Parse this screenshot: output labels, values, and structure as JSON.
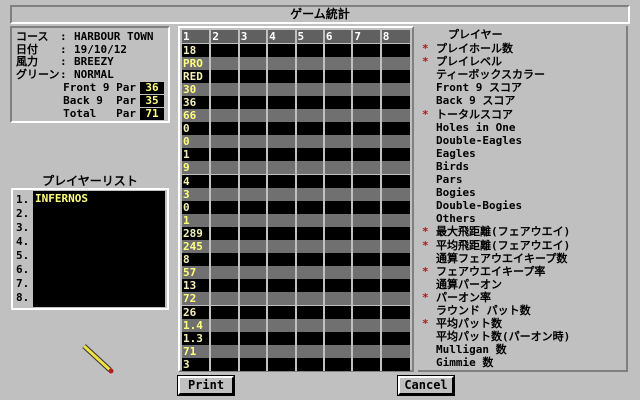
{
  "title": "ゲーム統計",
  "course_info": {
    "rows": [
      {
        "key": "コース",
        "value": "HARBOUR TOWN"
      },
      {
        "key": "日付",
        "value": "19/10/12"
      },
      {
        "key": "風力",
        "value": "BREEZY"
      },
      {
        "key": "グリーン",
        "value": "NORMAL"
      }
    ],
    "separator": ":",
    "pars": [
      {
        "label": "Front 9 Par",
        "value": "36"
      },
      {
        "label": "Back 9  Par",
        "value": "35"
      },
      {
        "label": "Total   Par",
        "value": "71"
      }
    ]
  },
  "player_list": {
    "label": "プレイヤーリスト",
    "numbers": [
      "1.",
      "2.",
      "3.",
      "4.",
      "5.",
      "6.",
      "7.",
      "8."
    ],
    "players": [
      "INFERNOS"
    ]
  },
  "grid": {
    "columns": [
      "1",
      "2",
      "3",
      "4",
      "5",
      "6",
      "7",
      "8"
    ],
    "player1_values": [
      "18",
      "PRO",
      "RED",
      "30",
      "36",
      "66",
      "0",
      "0",
      "1",
      "9",
      "4",
      "3",
      "0",
      "1",
      "289",
      "245",
      "8",
      "57",
      "13",
      "72",
      "26",
      "1.4",
      "1.3",
      "71",
      "3"
    ]
  },
  "stats": {
    "header": "プレイヤー",
    "star": "*",
    "labels": [
      {
        "text": "プレイホール数",
        "star": true
      },
      {
        "text": "プレイレベル",
        "star": true
      },
      {
        "text": "ティーボックスカラー",
        "star": false
      },
      {
        "text": "Front 9 スコア",
        "star": false
      },
      {
        "text": "Back 9 スコア",
        "star": false
      },
      {
        "text": "トータルスコア",
        "star": true
      },
      {
        "text": "Holes in One",
        "star": false
      },
      {
        "text": "Double-Eagles",
        "star": false
      },
      {
        "text": "Eagles",
        "star": false
      },
      {
        "text": "Birds",
        "star": false
      },
      {
        "text": "Pars",
        "star": false
      },
      {
        "text": "Bogies",
        "star": false
      },
      {
        "text": "Double-Bogies",
        "star": false
      },
      {
        "text": "Others",
        "star": false
      },
      {
        "text": "最大飛距離(フェアウエイ)",
        "star": true
      },
      {
        "text": "平均飛距離(フェアウエイ)",
        "star": true
      },
      {
        "text": "通算フェアウエイキープ数",
        "star": false
      },
      {
        "text": "フェアウエイキープ率",
        "star": true
      },
      {
        "text": "通算パーオン",
        "star": false
      },
      {
        "text": "パーオン率",
        "star": true
      },
      {
        "text": "ラウンド パット数",
        "star": false
      },
      {
        "text": "平均パット数",
        "star": true
      },
      {
        "text": "平均パット数(パーオン時)",
        "star": false
      },
      {
        "text": "Mulligan 数",
        "star": false
      },
      {
        "text": "Gimmie 数",
        "star": false
      }
    ]
  },
  "buttons": {
    "print": "Print",
    "cancel": "Cancel"
  }
}
